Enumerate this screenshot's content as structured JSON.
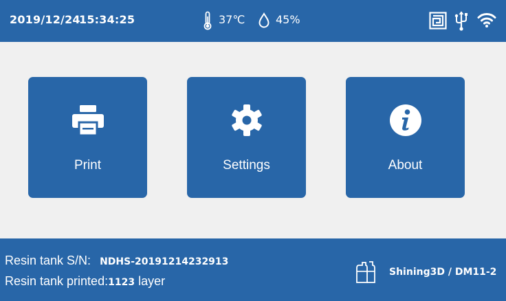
{
  "status_bar": {
    "date": "2019/12/24",
    "time": "15:34:25",
    "temperature": "37℃",
    "humidity": "45%",
    "icons": [
      "thermometer-icon",
      "droplet-icon",
      "nfc-icon",
      "usb-icon",
      "wifi-icon"
    ]
  },
  "menu": {
    "tiles": [
      {
        "label": "Print",
        "icon": "printer-icon"
      },
      {
        "label": "Settings",
        "icon": "gear-icon"
      },
      {
        "label": "About",
        "icon": "info-icon"
      }
    ]
  },
  "footer": {
    "sn_label": "Resin tank S/N:",
    "sn_value": "NDHS-20191214232913",
    "printed_label": "Resin tank printed:",
    "printed_value": "1123",
    "printed_unit": "layer",
    "device": "Shining3D / DM11-2",
    "icon": "resin-bottles-icon"
  },
  "colors": {
    "accent": "#2866a8",
    "background": "#f0f0f0",
    "text_on_accent": "#ffffff"
  }
}
